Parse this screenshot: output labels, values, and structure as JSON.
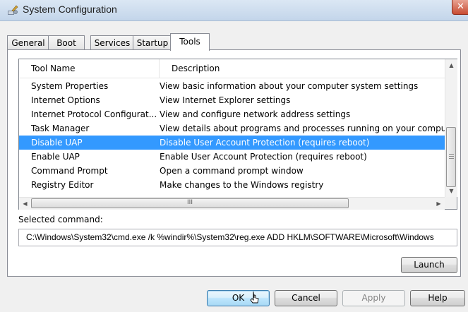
{
  "window": {
    "title": "System Configuration",
    "close_glyph": "✕"
  },
  "tabs": [
    {
      "label": "General",
      "active": false
    },
    {
      "label": "Boot",
      "active": false
    },
    {
      "label": "Services",
      "active": false
    },
    {
      "label": "Startup",
      "active": false
    },
    {
      "label": "Tools",
      "active": true
    }
  ],
  "list": {
    "columns": [
      "Tool Name",
      "Description"
    ],
    "rows": [
      {
        "name": "System Properties",
        "description": "View basic information about your computer system settings",
        "selected": false
      },
      {
        "name": "Internet Options",
        "description": "View Internet Explorer settings",
        "selected": false
      },
      {
        "name": "Internet Protocol Configurat...",
        "description": "View and configure network address settings",
        "selected": false
      },
      {
        "name": "Task Manager",
        "description": "View details about programs and processes running on your computer",
        "selected": false
      },
      {
        "name": "Disable UAP",
        "description": "Disable User Account Protection (requires reboot)",
        "selected": true
      },
      {
        "name": "Enable UAP",
        "description": "Enable User Account Protection (requires reboot)",
        "selected": false
      },
      {
        "name": "Command Prompt",
        "description": "Open a command prompt window",
        "selected": false
      },
      {
        "name": "Registry Editor",
        "description": "Make changes to the Windows registry",
        "selected": false
      }
    ]
  },
  "selected_command": {
    "label": "Selected command:",
    "value": "C:\\Windows\\System32\\cmd.exe /k %windir%\\System32\\reg.exe ADD HKLM\\SOFTWARE\\Microsoft\\Windows"
  },
  "buttons": {
    "launch": "Launch",
    "ok": "OK",
    "cancel": "Cancel",
    "apply": "Apply",
    "help": "Help"
  },
  "scrollbar": {
    "thumb_grip": "III"
  },
  "icons": {
    "app": "msconfig-icon",
    "close": "close-icon",
    "up": "scroll-up-arrow-icon",
    "down": "scroll-down-arrow-icon",
    "left": "scroll-left-arrow-icon",
    "right": "scroll-right-arrow-icon",
    "cursor": "mouse-pointer-icon"
  },
  "colors": {
    "selection": "#3399ff",
    "title_bar": "#c3d5ea",
    "close": "#c84c33"
  }
}
